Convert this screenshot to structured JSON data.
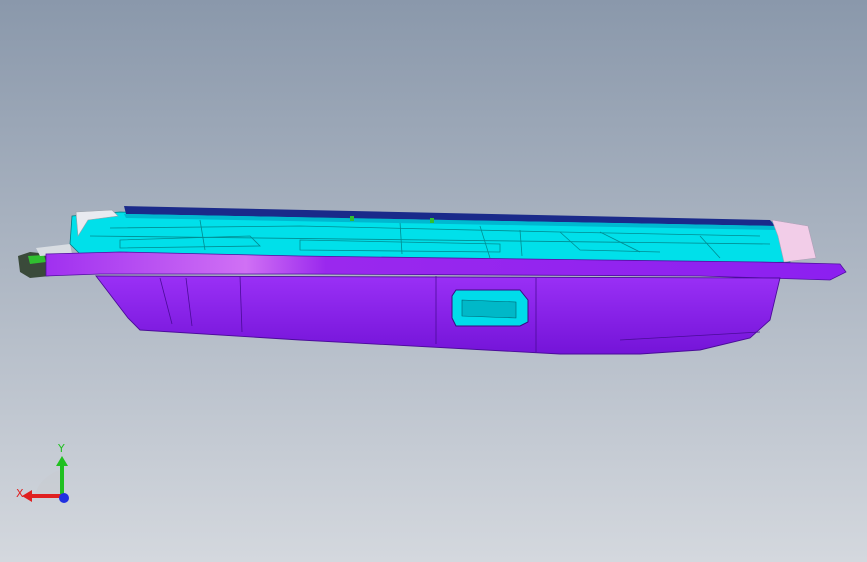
{
  "viewport": {
    "background_top": "#8a98ab",
    "background_bottom": "#d4d8de"
  },
  "model": {
    "body_color": "#8c20f0",
    "body_shadow_color": "#6a10c8",
    "inner_color": "#00e5ee",
    "top_edge_color": "#1a2a8a",
    "flange_color": "#b030f0",
    "end_cap_color": "#f0c8f0",
    "left_cap_color": "#3a4a3a",
    "accent_color": "#30c030"
  },
  "triad": {
    "x_label": "X",
    "y_label": "Y",
    "x_color": "#e02020",
    "y_color": "#20c020",
    "z_color": "#2030e0"
  }
}
